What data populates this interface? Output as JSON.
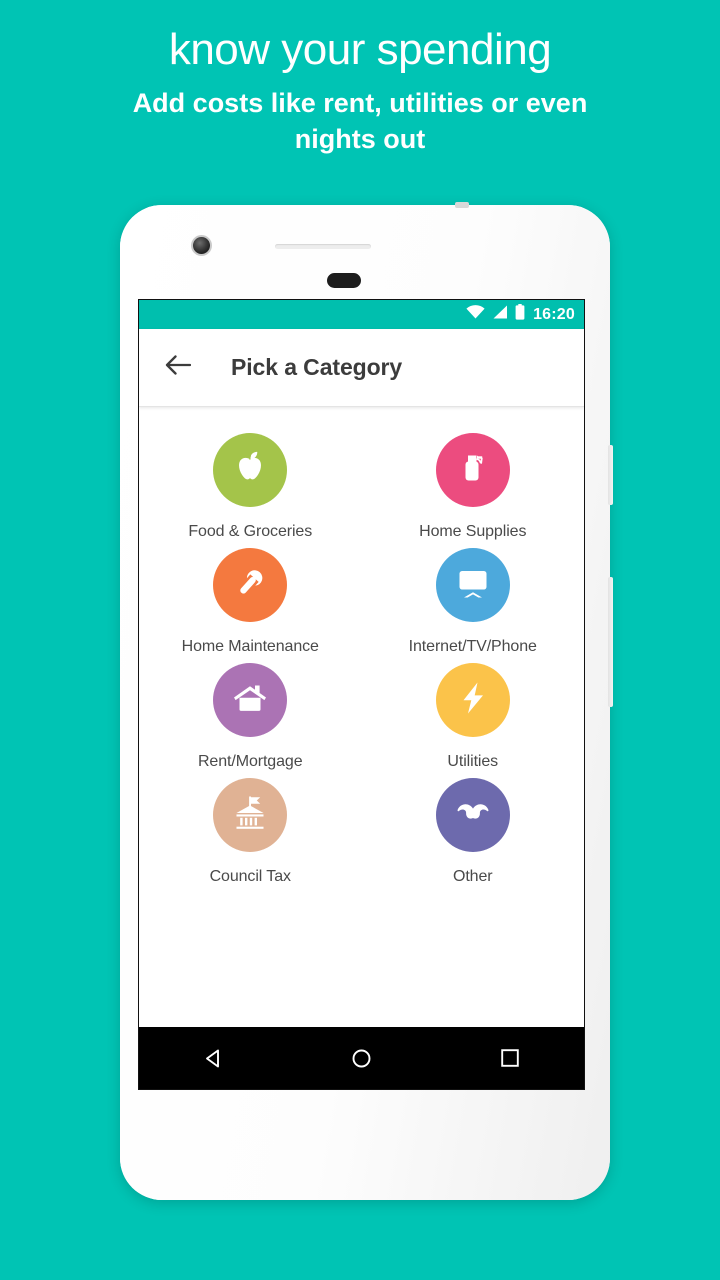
{
  "promo": {
    "title": "know your spending",
    "subtitle": "Add costs like rent, utilities or even nights out"
  },
  "colors": {
    "background": "#00c4b4",
    "statusbar": "#00bfae",
    "appbar_text": "#3c3c3c",
    "label_text": "#4a4a4a",
    "navbar": "#000000"
  },
  "phone": {
    "camera_icon": "front-camera-icon",
    "speaker_icon": "earpiece-speaker-icon",
    "sensor_icon": "proximity-sensor-icon",
    "power_button": "power-button",
    "volume_button": "volume-rocker-button"
  },
  "statusbar": {
    "wifi_icon": "wifi-icon",
    "signal_icon": "cellular-signal-icon",
    "battery_icon": "battery-full-icon",
    "time": "16:20"
  },
  "appbar": {
    "back_icon": "back-arrow-icon",
    "title": "Pick a Category"
  },
  "categories": [
    {
      "label": "Food & Groceries",
      "icon": "apple-icon",
      "color": "#a4c44a"
    },
    {
      "label": "Home Supplies",
      "icon": "spray-bottle-icon",
      "color": "#ec4c7f"
    },
    {
      "label": "Home Maintenance",
      "icon": "wrench-icon",
      "color": "#f4793f"
    },
    {
      "label": "Internet/TV/Phone",
      "icon": "television-icon",
      "color": "#4da9dc"
    },
    {
      "label": "Rent/Mortgage",
      "icon": "house-icon",
      "color": "#ab73b4"
    },
    {
      "label": "Utilities",
      "icon": "lightning-bolt-icon",
      "color": "#fbc34a"
    },
    {
      "label": "Council Tax",
      "icon": "government-building-icon",
      "color": "#e0b294"
    },
    {
      "label": "Other",
      "icon": "mustache-icon",
      "color": "#6d6aad"
    }
  ],
  "navbar": {
    "back_icon": "android-back-icon",
    "home_icon": "android-home-icon",
    "recents_icon": "android-recents-icon"
  }
}
